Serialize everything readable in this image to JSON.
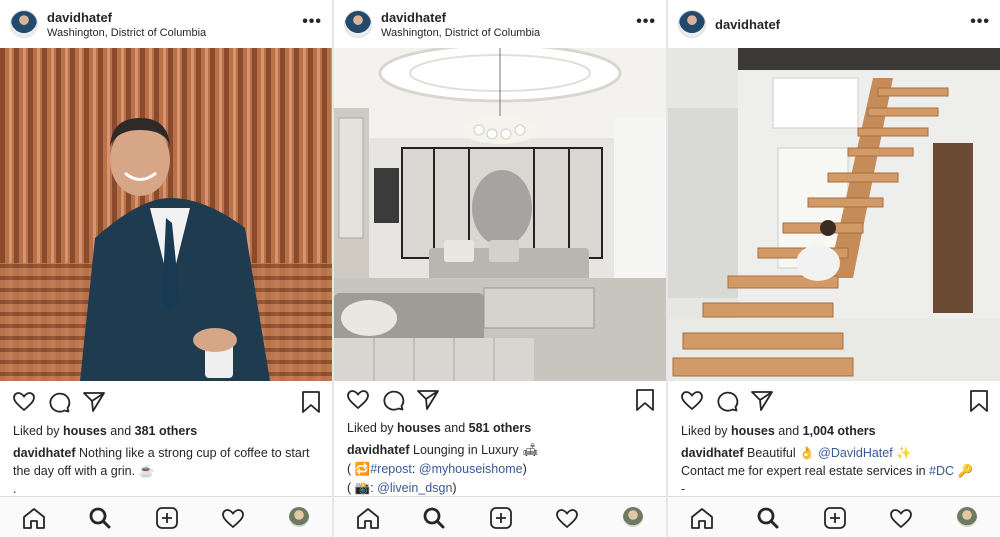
{
  "colors": {
    "link": "#385898",
    "nav_bg": "#fafafa",
    "text": "#262626"
  },
  "posts": [
    {
      "username": "davidhatef",
      "location": "Washington, District of Columbia",
      "liked_by_prefix": "Liked by",
      "liked_by_user": "houses",
      "liked_by_and": "and",
      "liked_by_others": "381 others",
      "caption_user": "davidhatef",
      "caption_text": "Nothing like a strong cup of coffee to start the day off with a grin. ☕",
      "caption_more": "."
    },
    {
      "username": "davidhatef",
      "location": "Washington, District of Columbia",
      "liked_by_prefix": "Liked by",
      "liked_by_user": "houses",
      "liked_by_and": "and",
      "liked_by_others": "581 others",
      "caption_user": "davidhatef",
      "caption_text": "Lounging in Luxury 🛋",
      "line2_open": "( 🔁",
      "line2_tag": "#repost",
      "line2_colon": ":",
      "line2_mention": "@myhouseishome",
      "line2_close": ")",
      "line3_open": "( 📸:",
      "line3_mention": "@livein_dsgn",
      "line3_close": ")"
    },
    {
      "username": "davidhatef",
      "location": "",
      "liked_by_prefix": "Liked by",
      "liked_by_user": "houses",
      "liked_by_and": "and",
      "liked_by_others": "1,004 others",
      "caption_user": "davidhatef",
      "caption_text": "Beautiful 👌",
      "caption_mention": "@DavidHatef",
      "caption_sparkle": "✨",
      "line2_text": "Contact me for expert real estate services in",
      "line2_tag": "#DC",
      "line2_emoji": "🔑",
      "line3_text": "-"
    }
  ],
  "more_label": "•••",
  "icons": {
    "post_actions": [
      "heart-icon",
      "comment-icon",
      "share-icon",
      "bookmark-icon"
    ],
    "bottom_nav": [
      "home-icon",
      "search-icon",
      "add-icon",
      "activity-heart-icon",
      "profile-avatar"
    ]
  }
}
